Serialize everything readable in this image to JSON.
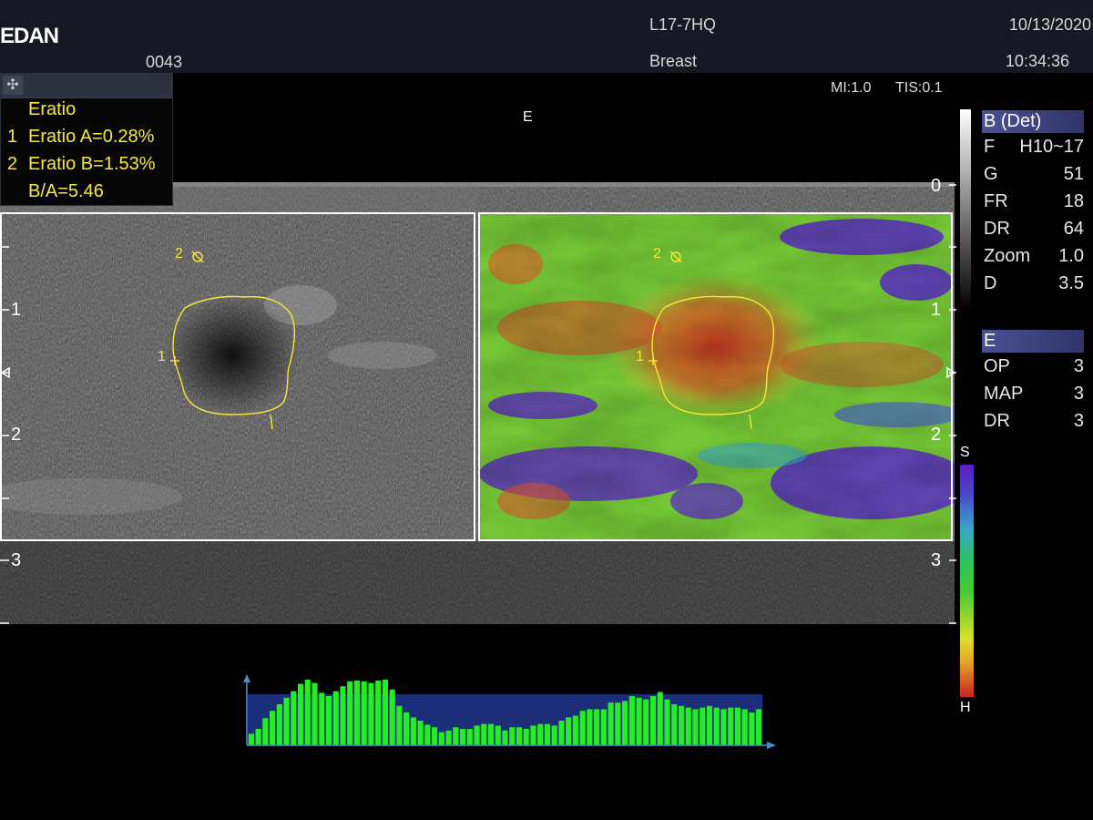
{
  "header": {
    "brand": "EDAN",
    "patient_id": "0043",
    "probe": "L17-7HQ",
    "preset": "Breast",
    "date": "10/13/2020",
    "time": "10:34:36",
    "mi": "MI:1.0",
    "tis": "TIS:0.1"
  },
  "measurement": {
    "move_icon": "move-cross-icon",
    "title": "Eratio",
    "rows": [
      {
        "index": "1",
        "label": "Eratio A=0.28%"
      },
      {
        "index": "2",
        "label": "Eratio B=1.53%"
      },
      {
        "index": "",
        "label": "B/A=5.46"
      }
    ]
  },
  "image": {
    "elasto_marker": "E",
    "depth_labels": [
      "0",
      "1",
      "2",
      "3"
    ],
    "roi_label_1": "1",
    "roi_label_2": "2",
    "colorbar_top": "S",
    "colorbar_bottom": "H",
    "colors": {
      "measurement_yellow": "#f7e93a",
      "histogram_green": "#22ee22",
      "histogram_bg": "#1c2e7a",
      "axis_arrow": "#4a8fc6"
    }
  },
  "sidebar": {
    "b_mode": {
      "title": "B (Det)",
      "params": [
        {
          "k": "F",
          "v": "H10~17"
        },
        {
          "k": "G",
          "v": "51"
        },
        {
          "k": "FR",
          "v": "18"
        },
        {
          "k": "DR",
          "v": "64"
        },
        {
          "k": "Zoom",
          "v": "1.0"
        },
        {
          "k": "D",
          "v": "3.5"
        }
      ]
    },
    "e_mode": {
      "title": "E",
      "params": [
        {
          "k": "OP",
          "v": "3"
        },
        {
          "k": "MAP",
          "v": "3"
        },
        {
          "k": "DR",
          "v": "3"
        }
      ]
    }
  },
  "histogram": {
    "values": [
      14,
      20,
      33,
      42,
      50,
      58,
      66,
      75,
      80,
      76,
      64,
      60,
      66,
      72,
      78,
      79,
      78,
      76,
      79,
      80,
      68,
      48,
      40,
      34,
      30,
      25,
      22,
      16,
      18,
      22,
      20,
      20,
      24,
      26,
      26,
      24,
      18,
      22,
      22,
      20,
      24,
      26,
      26,
      24,
      30,
      34,
      36,
      42,
      44,
      44,
      44,
      52,
      52,
      54,
      60,
      58,
      56,
      60,
      65,
      56,
      50,
      48,
      46,
      44,
      46,
      48,
      46,
      44,
      46,
      46,
      44,
      40,
      44
    ]
  }
}
